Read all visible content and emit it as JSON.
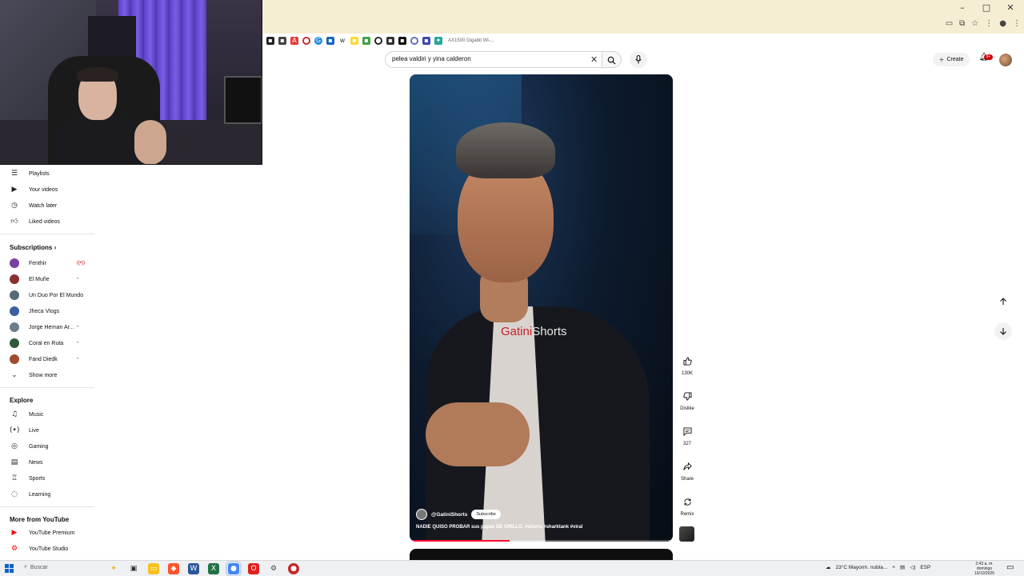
{
  "window": {
    "controls": [
      "–",
      "□",
      "✕"
    ]
  },
  "bookmarks": {
    "last_label": "AX1500 Gigabit Wi-..."
  },
  "search": {
    "value": "pelea valdiri y yina calderon"
  },
  "topbar": {
    "create_label": "Create",
    "notif_count": "9+"
  },
  "sidebar": {
    "you_items": [
      {
        "label": "Playlists",
        "icon": "playlist-icon"
      },
      {
        "label": "Your videos",
        "icon": "video-icon"
      },
      {
        "label": "Watch later",
        "icon": "clock-icon"
      },
      {
        "label": "Liked videos",
        "icon": "thumbs-up-icon"
      }
    ],
    "subscriptions_heading": "Subscriptions",
    "subscriptions": [
      {
        "label": "Fenthir",
        "color": "#7b3fa0",
        "badge": "live"
      },
      {
        "label": "El Muñe",
        "color": "#8a2f2f",
        "badge": "dot"
      },
      {
        "label": "Un Duo Por El Mundo",
        "color": "#556b7a",
        "badge": "dot"
      },
      {
        "label": "Jheca Vlogs",
        "color": "#3b5fa0",
        "badge": ""
      },
      {
        "label": "Jorge Hernan Ar...",
        "color": "#6b7d8a",
        "badge": "dot"
      },
      {
        "label": "Coral en Ruta",
        "color": "#2f5a3a",
        "badge": "dot"
      },
      {
        "label": "Fand Diedk",
        "color": "#a04a2f",
        "badge": "dot"
      }
    ],
    "show_more": "Show more",
    "explore_heading": "Explore",
    "explore": [
      {
        "label": "Music",
        "icon": "music-icon"
      },
      {
        "label": "Live",
        "icon": "live-icon"
      },
      {
        "label": "Gaming",
        "icon": "gaming-icon"
      },
      {
        "label": "News",
        "icon": "news-icon"
      },
      {
        "label": "Sports",
        "icon": "trophy-icon"
      },
      {
        "label": "Learning",
        "icon": "bulb-icon"
      }
    ],
    "more_heading": "More from YouTube",
    "more": [
      {
        "label": "YouTube Premium",
        "color": "#ff0000"
      },
      {
        "label": "YouTube Studio",
        "color": "#ff0000"
      }
    ]
  },
  "short": {
    "watermark_red": "Gatini",
    "watermark_white": "Shorts",
    "channel": "@GatiniShorts",
    "subscribe": "Subscribe",
    "caption": "NADIE QUISO PROBAR sus papas DE GRILLO. #shorts #sharktank #viral",
    "progress": 0.38
  },
  "actions": {
    "like_count": "130K",
    "dislike_label": "Dislike",
    "comments_count": "327",
    "share_label": "Share",
    "remix_label": "Remix"
  },
  "taskbar": {
    "search_label": "Buscar",
    "weather": "23°C  Mayorm. nubla...",
    "lang": "ESP",
    "time": "2:43 a. m.",
    "day": "domingo",
    "date": "19/10/2025"
  },
  "colors": {
    "accent": "#ff0033",
    "brand": "#ff0000"
  }
}
